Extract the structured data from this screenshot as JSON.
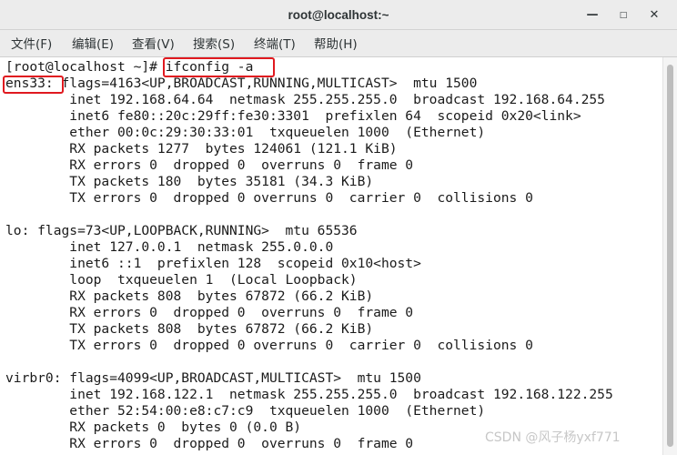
{
  "window": {
    "title": "root@localhost:~",
    "controls": {
      "minimize": "—",
      "maximize": "□",
      "close": "✕"
    }
  },
  "menubar": {
    "items": [
      "文件(F)",
      "编辑(E)",
      "查看(V)",
      "搜索(S)",
      "终端(T)",
      "帮助(H)"
    ]
  },
  "terminal": {
    "prompt": "[root@localhost ~]#",
    "command": "ifconfig -a",
    "lines": [
      "[root@localhost ~]# ifconfig -a",
      "ens33: flags=4163<UP,BROADCAST,RUNNING,MULTICAST>  mtu 1500",
      "        inet 192.168.64.64  netmask 255.255.255.0  broadcast 192.168.64.255",
      "        inet6 fe80::20c:29ff:fe30:3301  prefixlen 64  scopeid 0x20<link>",
      "        ether 00:0c:29:30:33:01  txqueuelen 1000  (Ethernet)",
      "        RX packets 1277  bytes 124061 (121.1 KiB)",
      "        RX errors 0  dropped 0  overruns 0  frame 0",
      "        TX packets 180  bytes 35181 (34.3 KiB)",
      "        TX errors 0  dropped 0 overruns 0  carrier 0  collisions 0",
      "",
      "lo: flags=73<UP,LOOPBACK,RUNNING>  mtu 65536",
      "        inet 127.0.0.1  netmask 255.0.0.0",
      "        inet6 ::1  prefixlen 128  scopeid 0x10<host>",
      "        loop  txqueuelen 1  (Local Loopback)",
      "        RX packets 808  bytes 67872 (66.2 KiB)",
      "        RX errors 0  dropped 0  overruns 0  frame 0",
      "        TX packets 808  bytes 67872 (66.2 KiB)",
      "        TX errors 0  dropped 0 overruns 0  carrier 0  collisions 0",
      "",
      "virbr0: flags=4099<UP,BROADCAST,MULTICAST>  mtu 1500",
      "        inet 192.168.122.1  netmask 255.255.255.0  broadcast 192.168.122.255",
      "        ether 52:54:00:e8:c7:c9  txqueuelen 1000  (Ethernet)",
      "        RX packets 0  bytes 0 (0.0 B)",
      "        RX errors 0  dropped 0  overruns 0  frame 0"
    ]
  },
  "annotations": {
    "highlight_color": "#e0191f",
    "highlighted": [
      "ifconfig -a",
      "ens33:"
    ]
  },
  "watermark": "CSDN @风子杨yxf771"
}
